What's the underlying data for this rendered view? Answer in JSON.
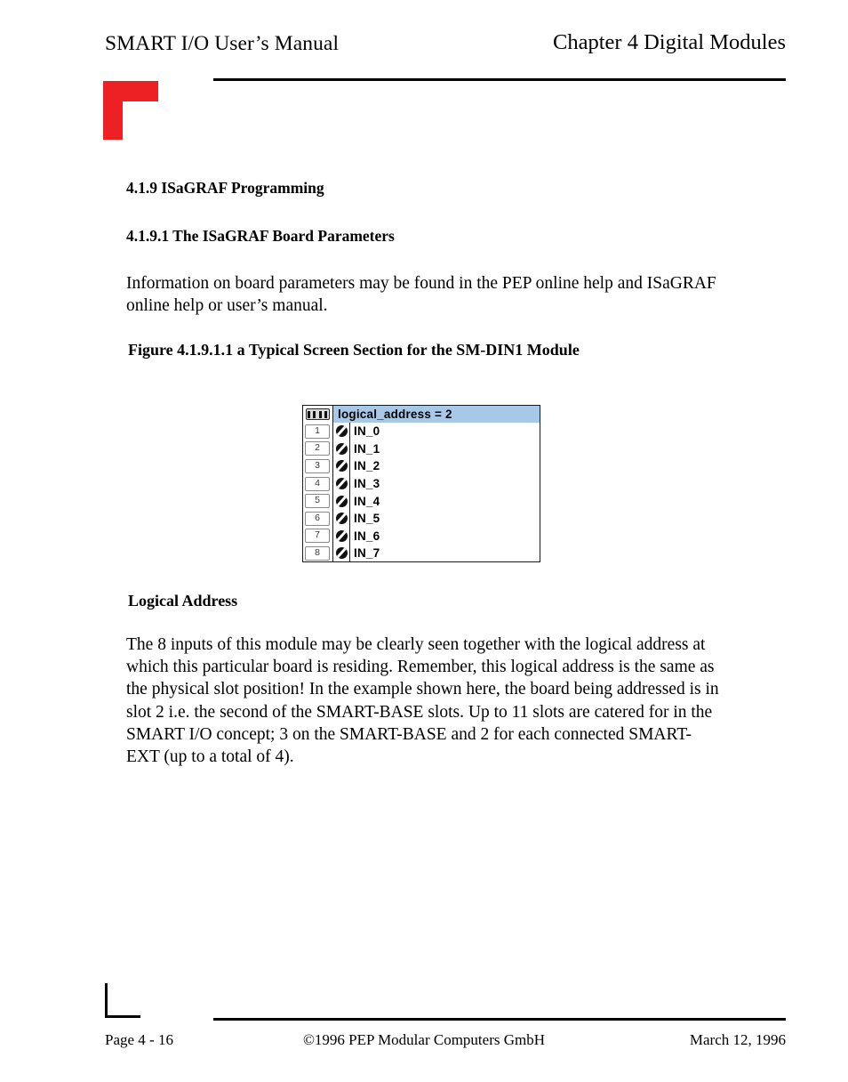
{
  "header": {
    "left_title": "SMART I/O User’s Manual",
    "right_title": "Chapter 4  Digital Modules"
  },
  "marks": {
    "top_corner_color": "#ED2024",
    "bottom_corner_color": "#000000"
  },
  "content": {
    "heading_section": "4.1.9 ISaGRAF Programming",
    "heading_subsection": "4.1.9.1 The ISaGRAF Board Parameters",
    "paragraph_intro": "Information on board parameters may be found in the PEP online help and ISaGRAF online help or user’s manual.",
    "figure_caption": "Figure 4.1.9.1.1 a Typical Screen Section for the SM-DIN1 Module",
    "heading_logical_address": "Logical Address",
    "paragraph_body": "The 8 inputs of this module may be clearly seen together with the logical address at which this particular board is residing. Remember, this logical address is the same as the physical slot position! In the example shown here, the board being addressed is in slot 2 i.e. the second of the SMART-BASE slots. Up to 11 slots are catered for in the SMART I/O concept; 3 on the SMART-BASE and 2 for each connected SMART-EXT (up to a total of 4)."
  },
  "isagraf_widget": {
    "title": "logical_address = 2",
    "titlebar_color": "#A8C8E8",
    "header_icon": "chip-icon",
    "row_state_icon": "circle-slash-icon",
    "rows": [
      {
        "pin": "1",
        "label": "IN_0"
      },
      {
        "pin": "2",
        "label": "IN_1"
      },
      {
        "pin": "3",
        "label": "IN_2"
      },
      {
        "pin": "4",
        "label": "IN_3"
      },
      {
        "pin": "5",
        "label": "IN_4"
      },
      {
        "pin": "6",
        "label": "IN_5"
      },
      {
        "pin": "7",
        "label": "IN_6"
      },
      {
        "pin": "8",
        "label": "IN_7"
      }
    ]
  },
  "footer": {
    "page_number": "Page 4 - 16",
    "copyright": "©1996 PEP Modular Computers GmbH",
    "date": "March 12, 1996"
  }
}
